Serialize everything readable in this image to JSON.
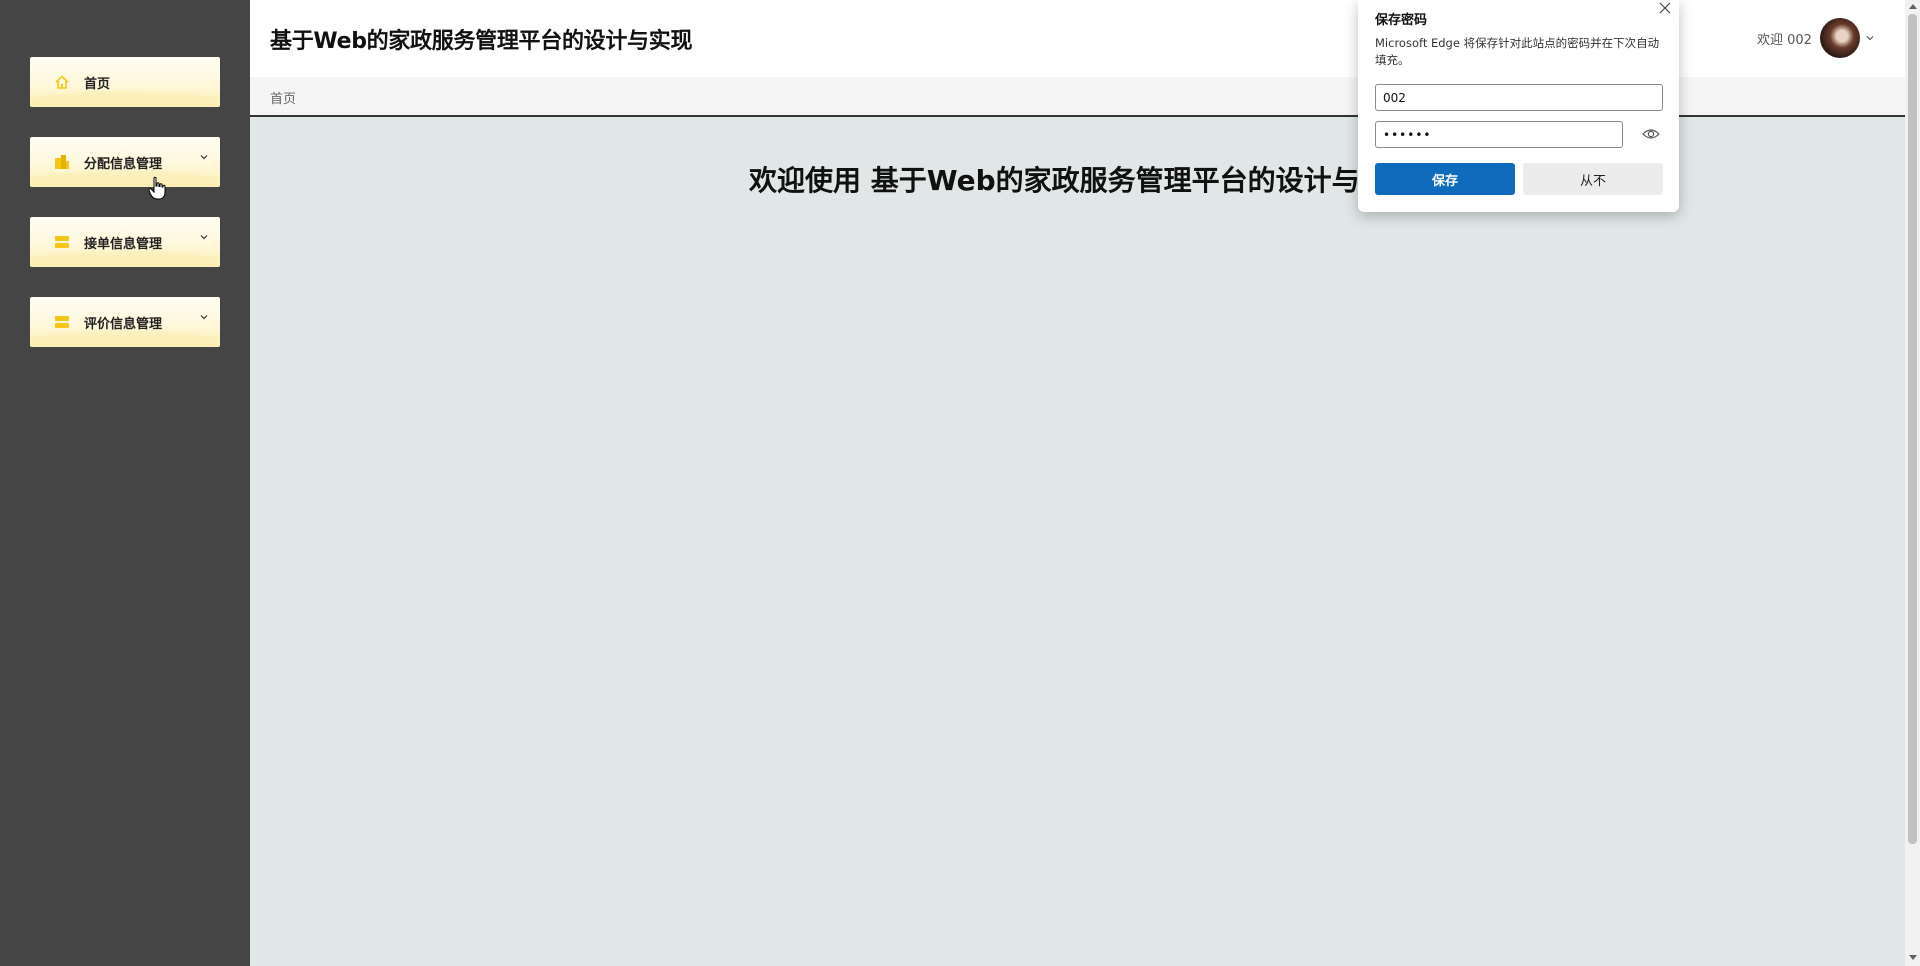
{
  "app": {
    "title": "基于Web的家政服务管理平台的设计与实现"
  },
  "header": {
    "welcome_text": "欢迎 002"
  },
  "sidebar": {
    "items": [
      {
        "label": "首页",
        "icon": "home-icon"
      },
      {
        "label": "分配信息管理",
        "icon": "buildings-icon"
      },
      {
        "label": "接单信息管理",
        "icon": "list-icon"
      },
      {
        "label": "评价信息管理",
        "icon": "list-icon"
      }
    ]
  },
  "breadcrumb": {
    "current": "首页"
  },
  "main": {
    "heading": "欢迎使用 基于Web的家政服务管理平台的设计与实现"
  },
  "dialog": {
    "title": "保存密码",
    "description": "Microsoft Edge 将保存针对此站点的密码并在下次自动填充。",
    "username": "002",
    "password": "••••••",
    "save_label": "保存",
    "never_label": "从不"
  },
  "colors": {
    "sidebar_bg": "#454545",
    "menu_accent": "#f5c518",
    "save_blue": "#0f6cbd",
    "content_bg": "#e1e7e7"
  }
}
